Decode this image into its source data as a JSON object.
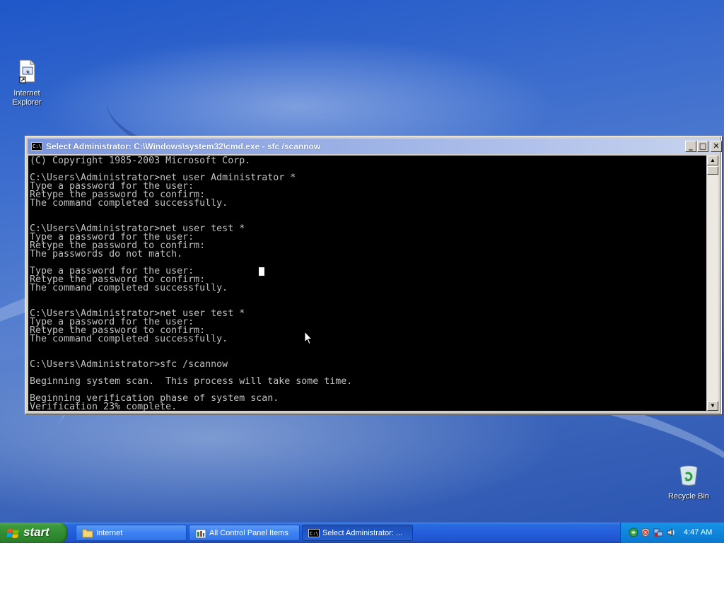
{
  "desktop": {
    "icons": [
      {
        "label_line1": "Internet",
        "label_line2": "Explorer",
        "icon": "internet-explorer-shortcut-icon"
      },
      {
        "label_line1": "Recycle Bin",
        "icon": "recycle-bin-icon"
      }
    ]
  },
  "window": {
    "title": "Select Administrator: C:\\Windows\\system32\\cmd.exe - sfc  /scannow",
    "icon": "console-icon",
    "title_icon_text": "C:\\",
    "minimize": "_",
    "maximize": "□",
    "close": "✕"
  },
  "console": {
    "lines": [
      "(C) Copyright 1985-2003 Microsoft Corp.",
      "",
      "C:\\Users\\Administrator>net user Administrator *",
      "Type a password for the user:",
      "Retype the password to confirm:",
      "The command completed successfully.",
      "",
      "",
      "C:\\Users\\Administrator>net user test *",
      "Type a password for the user:",
      "Retype the password to confirm:",
      "The passwords do not match.",
      "",
      "Type a password for the user:",
      "Retype the password to confirm:",
      "The command completed successfully.",
      "",
      "",
      "C:\\Users\\Administrator>net user test *",
      "Type a password for the user:",
      "Retype the password to confirm:",
      "The command completed successfully.",
      "",
      "",
      "C:\\Users\\Administrator>sfc /scannow",
      "",
      "Beginning system scan.  This process will take some time.",
      "",
      "Beginning verification phase of system scan.",
      "Verification 23% complete."
    ]
  },
  "scrollbar": {
    "up_arrow": "▲",
    "down_arrow": "▼"
  },
  "taskbar": {
    "start_label": "start",
    "tasks": [
      {
        "label": "Internet",
        "icon": "folder-icon",
        "active": false
      },
      {
        "label": "All Control Panel Items",
        "icon": "control-panel-icon",
        "active": false
      },
      {
        "label": "Select Administrator: ...",
        "icon": "console-icon",
        "active": true
      }
    ],
    "tray_icons": [
      "network-icon",
      "security-alert-icon",
      "network-status-icon",
      "volume-icon"
    ],
    "clock": "4:47 AM"
  },
  "colors": {
    "console_bg": "#000000",
    "console_text": "#c0c0c0",
    "taskbar": "#245edb",
    "start_button": "#3c9a3c",
    "title_gradient_start": "#7a96df"
  }
}
